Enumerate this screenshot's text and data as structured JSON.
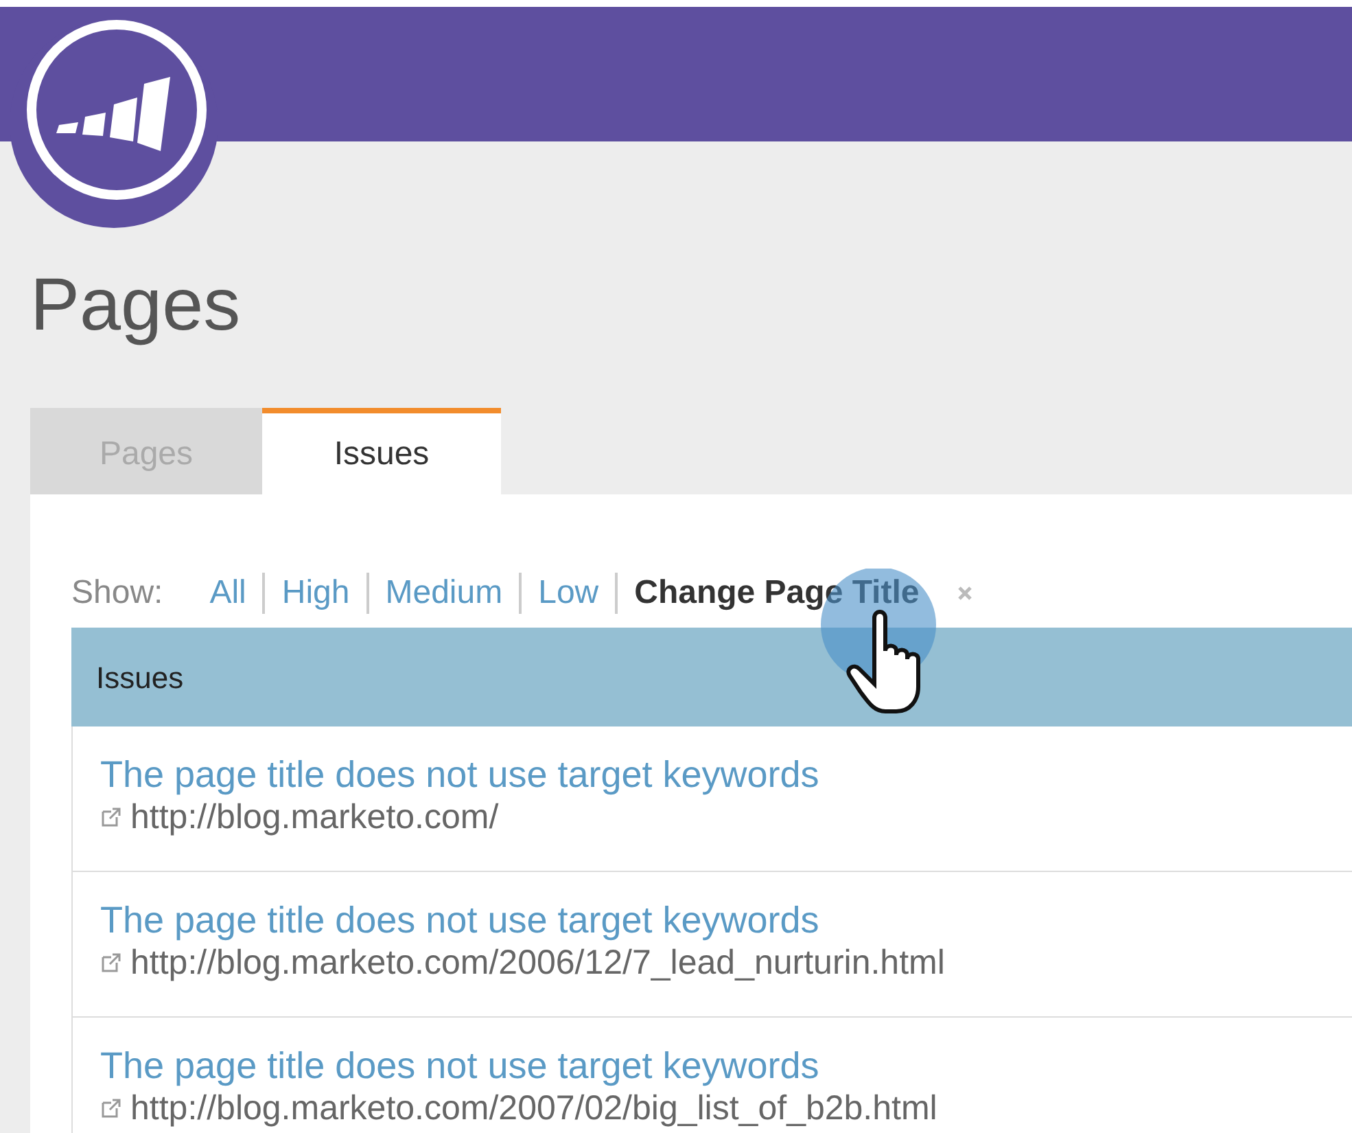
{
  "page_title": "Pages",
  "tabs": [
    {
      "label": "Pages",
      "selected": false
    },
    {
      "label": "Issues",
      "selected": true
    }
  ],
  "filter": {
    "label": "Show:",
    "options": [
      {
        "label": "All",
        "selected": false
      },
      {
        "label": "High",
        "selected": false
      },
      {
        "label": "Medium",
        "selected": false
      },
      {
        "label": "Low",
        "selected": false
      },
      {
        "label": "Change Page Title",
        "selected": true
      }
    ]
  },
  "table": {
    "columns": [
      "Issues"
    ],
    "rows": [
      {
        "issue": "The page title does not use target keywords",
        "url": "http://blog.marketo.com/"
      },
      {
        "issue": "The page title does not use target keywords",
        "url": "http://blog.marketo.com/2006/12/7_lead_nurturin.html"
      },
      {
        "issue": "The page title does not use target keywords",
        "url": "http://blog.marketo.com/2007/02/big_list_of_b2b.html"
      }
    ]
  }
}
